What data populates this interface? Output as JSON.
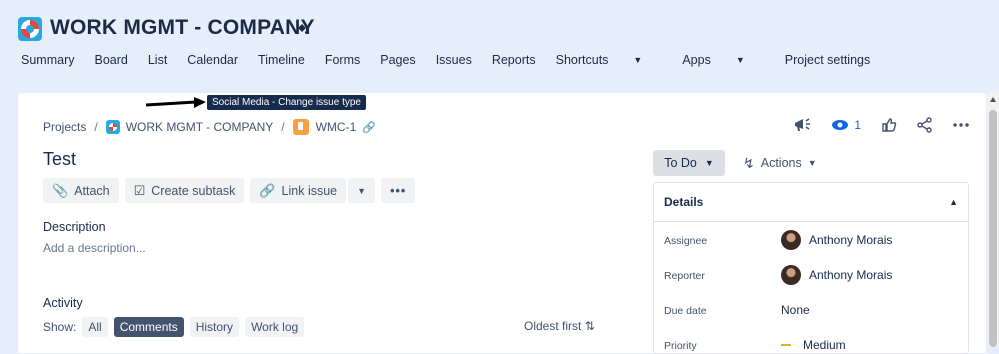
{
  "header": {
    "project_title": "WORK MGMT - COMPANY"
  },
  "nav": {
    "items": [
      "Summary",
      "Board",
      "List",
      "Calendar",
      "Timeline",
      "Forms",
      "Pages",
      "Issues",
      "Reports"
    ],
    "shortcuts": "Shortcuts",
    "apps": "Apps",
    "settings": "Project settings"
  },
  "tooltip": "Social Media - Change issue type",
  "breadcrumb": {
    "projects": "Projects",
    "project": "WORK MGMT - COMPANY",
    "issue_key": "WMC-1"
  },
  "top_actions": {
    "watch_count": "1"
  },
  "issue": {
    "title": "Test",
    "attach": "Attach",
    "create_subtask": "Create subtask",
    "link_issue": "Link issue",
    "description_label": "Description",
    "description_placeholder": "Add a description...",
    "activity_label": "Activity",
    "show_label": "Show:",
    "filters": [
      "All",
      "Comments",
      "History",
      "Work log"
    ],
    "sort_label": "Oldest first"
  },
  "status": {
    "label": "To Do",
    "actions_label": "Actions"
  },
  "details": {
    "heading": "Details",
    "assignee_label": "Assignee",
    "assignee": "Anthony Morais",
    "reporter_label": "Reporter",
    "reporter": "Anthony Morais",
    "due_label": "Due date",
    "due_value": "None",
    "priority_label": "Priority",
    "priority_value": "Medium"
  }
}
